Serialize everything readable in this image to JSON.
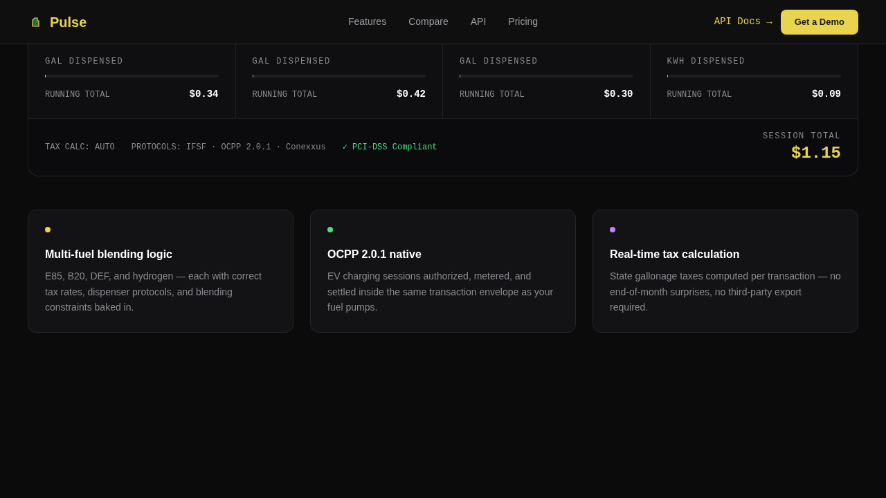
{
  "header": {
    "brand": "Pulse",
    "nav": [
      "Features",
      "Compare",
      "API",
      "Pricing"
    ],
    "docs_link": "API Docs →",
    "cta": "Get a Demo"
  },
  "meters": [
    {
      "unit": "GAL DISPENSED",
      "level": 0.004,
      "color": "#e8d44d",
      "total_label": "RUNNING TOTAL",
      "total": "$0.34"
    },
    {
      "unit": "GAL DISPENSED",
      "level": 0.004,
      "color": "#c4a0f0",
      "total_label": "RUNNING TOTAL",
      "total": "$0.42"
    },
    {
      "unit": "GAL DISPENSED",
      "level": 0.004,
      "color": "#7ec4e8",
      "total_label": "RUNNING TOTAL",
      "total": "$0.30"
    },
    {
      "unit": "KWH DISPENSED",
      "level": 0.004,
      "color": "#4ade80",
      "total_label": "RUNNING TOTAL",
      "total": "$0.09"
    }
  ],
  "footer": {
    "tax": "TAX CALC: AUTO",
    "protocols": "PROTOCOLS: IFSF · OCPP 2.0.1 · Conexxus",
    "compliance": "✓ PCI-DSS Compliant",
    "session_label": "SESSION TOTAL",
    "session_total": "$1.15"
  },
  "features": [
    {
      "color": "#e8d44d",
      "title": "Multi-fuel blending logic",
      "text": "E85, B20, DEF, and hydrogen — each with correct tax rates, dispenser protocols, and blending constraints baked in."
    },
    {
      "color": "#4ade80",
      "title": "OCPP 2.0.1 native",
      "text": "EV charging sessions authorized, metered, and settled inside the same transaction envelope as your fuel pumps."
    },
    {
      "color": "#c084fc",
      "title": "Real-time tax calculation",
      "text": "State gallonage taxes computed per transaction — no end-of-month surprises, no third-party export required."
    }
  ]
}
